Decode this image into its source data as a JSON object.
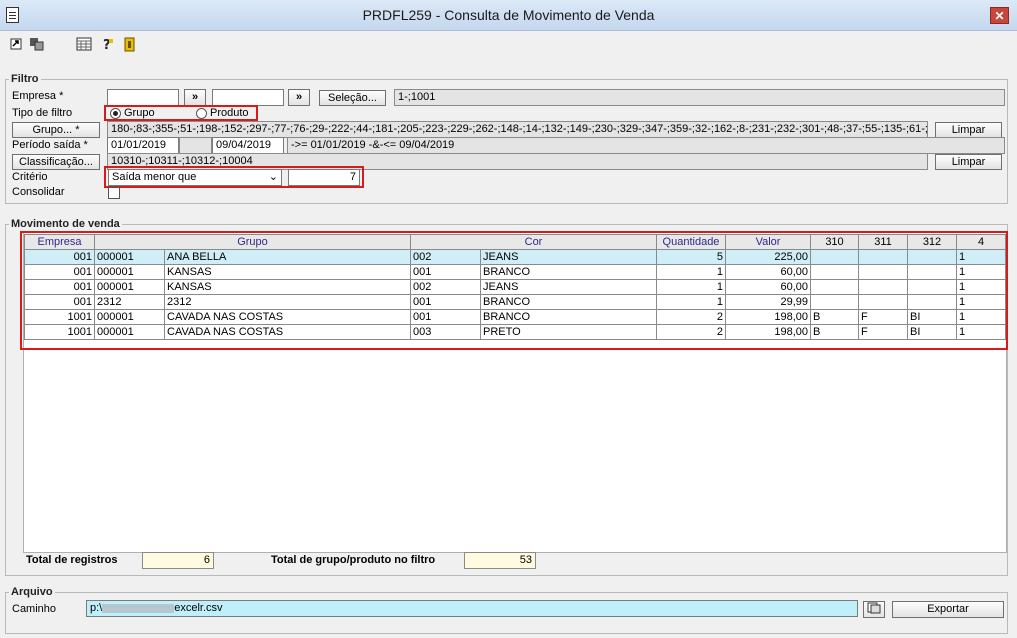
{
  "window": {
    "title": "PRDFL259 - Consulta de Movimento de Venda",
    "close_glyph": "✕"
  },
  "toolbar": {
    "icons": [
      "open-icon",
      "copy-icon",
      "calculator-icon",
      "help-icon",
      "exit-icon"
    ]
  },
  "filtro": {
    "title": "Filtro",
    "empresa_label": "Empresa *",
    "empresa_from": "",
    "empresa_to": "",
    "arrow": "»",
    "selecao_label": "Seleção...",
    "selecao_value": "1-;1001",
    "tipo_label": "Tipo de filtro",
    "tipo_options": [
      "Grupo",
      "Produto"
    ],
    "tipo_selected": "Grupo",
    "grupo_button": "Grupo... *",
    "grupo_value": "180-;83-;355-;51-;198-;152-;297-;77-;76-;29-;222-;44-;181-;205-;223-;229-;262-;148-;14-;132-;149-;230-;329-;347-;359-;32-;162-;8-;231-;232-;301-;48-;37-;55-;135-;61-;",
    "limpar_label": "Limpar",
    "periodo_label": "Período saída *",
    "periodo_from": "01/01/2019",
    "periodo_to": "09/04/2019",
    "periodo_desc": "->= 01/01/2019 -&-<= 09/04/2019",
    "classificacao_button": "Classificação...",
    "classificacao_value": "10310-;10311-;10312-;10004",
    "criterio_label": "Critério",
    "criterio_select": "Saída menor que",
    "criterio_value": "7",
    "consolidar_label": "Consolidar",
    "consolidar_checked": false
  },
  "movimento": {
    "title": "Movimento de venda",
    "columns": [
      "Empresa",
      "Grupo",
      "Cor",
      "Quantidade",
      "Valor",
      "310",
      "311",
      "312",
      "4"
    ],
    "rows": [
      [
        "001",
        "000001",
        "ANA BELLA",
        "002",
        "JEANS",
        "5",
        "225,00",
        "",
        "",
        "",
        "1"
      ],
      [
        "001",
        "000001",
        "KANSAS",
        "001",
        "BRANCO",
        "1",
        "60,00",
        "",
        "",
        "",
        "1"
      ],
      [
        "001",
        "000001",
        "KANSAS",
        "002",
        "JEANS",
        "1",
        "60,00",
        "",
        "",
        "",
        "1"
      ],
      [
        "001",
        "2312",
        "2312",
        "001",
        "BRANCO",
        "1",
        "29,99",
        "",
        "",
        "",
        "1"
      ],
      [
        "1001",
        "000001",
        "CAVADA NAS COSTAS",
        "001",
        "BRANCO",
        "2",
        "198,00",
        "B",
        "F",
        "BI",
        "1"
      ],
      [
        "1001",
        "000001",
        "CAVADA NAS COSTAS",
        "003",
        "PRETO",
        "2",
        "198,00",
        "B",
        "F",
        "BI",
        "1"
      ]
    ],
    "selected_row": 0,
    "total_registros_label": "Total de registros",
    "total_registros": "6",
    "total_grupo_label": "Total de grupo/produto no filtro",
    "total_grupo": "53"
  },
  "arquivo": {
    "title": "Arquivo",
    "caminho_label": "Caminho",
    "caminho_prefix": "p:\\",
    "caminho_suffix": "excelr.csv",
    "exportar_label": "Exportar"
  },
  "colors": {
    "highlight": "#d41c1c",
    "selected_row": "#cfeef7",
    "header_text": "#2b2b8c"
  }
}
